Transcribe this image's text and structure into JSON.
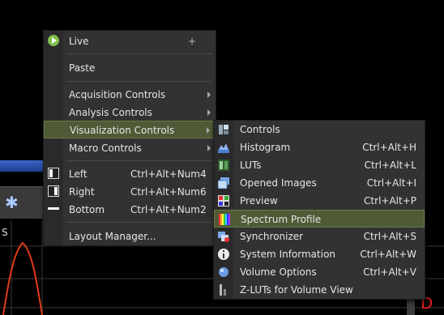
{
  "main_menu": {
    "live": {
      "label": "Live",
      "suffix": "+"
    },
    "paste": "Paste",
    "acquisition": "Acquisition Controls",
    "analysis": "Analysis Controls",
    "visualization": "Visualization Controls",
    "macro": "Macro Controls",
    "left": {
      "label": "Left",
      "shortcut": "Ctrl+Alt+Num4"
    },
    "right": {
      "label": "Right",
      "shortcut": "Ctrl+Alt+Num6"
    },
    "bottom": {
      "label": "Bottom",
      "shortcut": "Ctrl+Alt+Num2"
    },
    "layout_manager": "Layout Manager..."
  },
  "submenu": {
    "items": [
      {
        "label": "Controls",
        "shortcut": "",
        "icon": "controls-icon"
      },
      {
        "label": "Histogram",
        "shortcut": "Ctrl+Alt+H",
        "icon": "histogram-icon"
      },
      {
        "label": "LUTs",
        "shortcut": "Ctrl+Alt+L",
        "icon": "luts-icon"
      },
      {
        "label": "Opened Images",
        "shortcut": "Ctrl+Alt+I",
        "icon": "opened-images-icon"
      },
      {
        "label": "Preview",
        "shortcut": "Ctrl+Alt+P",
        "icon": "preview-icon"
      },
      {
        "label": "Spectrum Profile",
        "shortcut": "",
        "icon": "spectrum-profile-icon"
      },
      {
        "label": "Synchronizer",
        "shortcut": "Ctrl+Alt+S",
        "icon": "synchronizer-icon"
      },
      {
        "label": "System Information",
        "shortcut": "Ctrl+Alt+W",
        "icon": "info-icon"
      },
      {
        "label": "Volume Options",
        "shortcut": "Ctrl+Alt+V",
        "icon": "volume-options-icon"
      },
      {
        "label": "Z-LUTs for Volume View",
        "shortcut": "",
        "icon": "z-luts-icon"
      }
    ]
  },
  "background": {
    "corner_letter": "D",
    "side_letter": "S"
  },
  "colors": {
    "highlight": "#4f5a36",
    "menu_bg": "#323232",
    "accent_red": "#ff2020"
  }
}
